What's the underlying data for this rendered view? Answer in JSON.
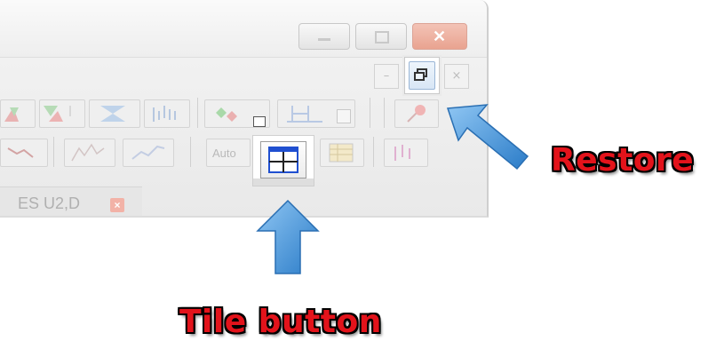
{
  "window": {
    "caption_buttons": [
      {
        "name": "minimize",
        "glyph": "▭"
      },
      {
        "name": "maximize",
        "glyph": "▢"
      },
      {
        "name": "close",
        "glyph": "✕"
      }
    ],
    "mdi_buttons": {
      "minimize_glyph": "–",
      "restore_glyph": "🗗",
      "close_glyph": "×"
    }
  },
  "toolbar": {
    "auto_label": "Auto"
  },
  "tab": {
    "label": "ES U2,D",
    "close_glyph": "×"
  },
  "callouts": {
    "restore": "Restore",
    "tile": "Tile button"
  },
  "colors": {
    "callout_text": "#e3131b",
    "arrow_blue": "#3f8fd6",
    "accent_blue": "#1f4fd0"
  }
}
